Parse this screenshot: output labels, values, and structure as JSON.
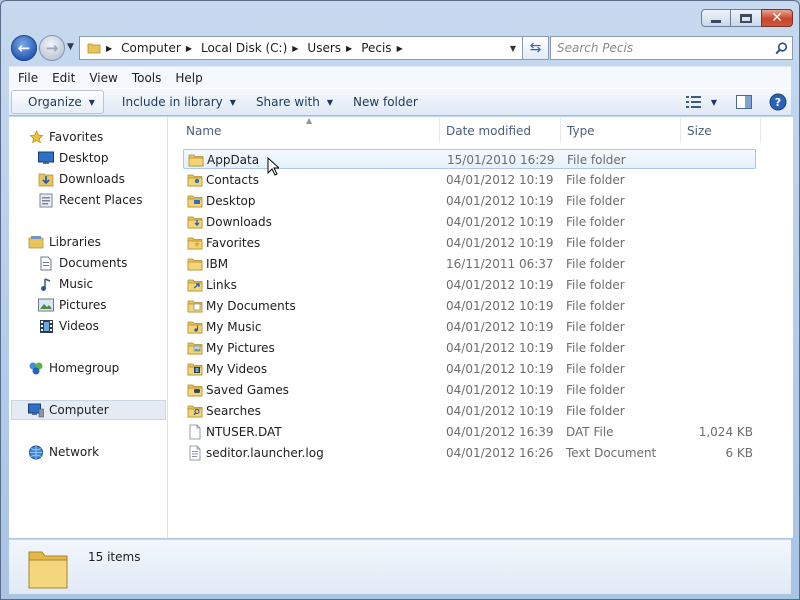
{
  "address": {
    "crumbs": [
      "Computer",
      "Local Disk (C:)",
      "Users",
      "Pecis"
    ],
    "search_placeholder": "Search Pecis"
  },
  "menu": [
    "File",
    "Edit",
    "View",
    "Tools",
    "Help"
  ],
  "commands": {
    "organize": "Organize",
    "include_in_library": "Include in library",
    "share_with": "Share with",
    "new_folder": "New folder"
  },
  "nav": {
    "favorites": {
      "label": "Favorites",
      "items": [
        "Desktop",
        "Downloads",
        "Recent Places"
      ]
    },
    "libraries": {
      "label": "Libraries",
      "items": [
        "Documents",
        "Music",
        "Pictures",
        "Videos"
      ]
    },
    "homegroup": "Homegroup",
    "computer": "Computer",
    "network": "Network"
  },
  "columns": {
    "name": "Name",
    "date": "Date modified",
    "type": "Type",
    "size": "Size"
  },
  "files": [
    {
      "name": "AppData",
      "date": "15/01/2010 16:29",
      "type": "File folder",
      "size": "",
      "icon": "folder-icon",
      "selected": true
    },
    {
      "name": "Contacts",
      "date": "04/01/2012 10:19",
      "type": "File folder",
      "size": "",
      "icon": "contacts-folder-icon"
    },
    {
      "name": "Desktop",
      "date": "04/01/2012 10:19",
      "type": "File folder",
      "size": "",
      "icon": "desktop-folder-icon"
    },
    {
      "name": "Downloads",
      "date": "04/01/2012 10:19",
      "type": "File folder",
      "size": "",
      "icon": "downloads-folder-icon"
    },
    {
      "name": "Favorites",
      "date": "04/01/2012 10:19",
      "type": "File folder",
      "size": "",
      "icon": "favorites-folder-icon"
    },
    {
      "name": "IBM",
      "date": "16/11/2011 06:37",
      "type": "File folder",
      "size": "",
      "icon": "folder-icon"
    },
    {
      "name": "Links",
      "date": "04/01/2012 10:19",
      "type": "File folder",
      "size": "",
      "icon": "links-folder-icon"
    },
    {
      "name": "My Documents",
      "date": "04/01/2012 10:19",
      "type": "File folder",
      "size": "",
      "icon": "documents-folder-icon"
    },
    {
      "name": "My Music",
      "date": "04/01/2012 10:19",
      "type": "File folder",
      "size": "",
      "icon": "music-folder-icon"
    },
    {
      "name": "My Pictures",
      "date": "04/01/2012 10:19",
      "type": "File folder",
      "size": "",
      "icon": "pictures-folder-icon"
    },
    {
      "name": "My Videos",
      "date": "04/01/2012 10:19",
      "type": "File folder",
      "size": "",
      "icon": "videos-folder-icon"
    },
    {
      "name": "Saved Games",
      "date": "04/01/2012 10:19",
      "type": "File folder",
      "size": "",
      "icon": "saved-games-folder-icon"
    },
    {
      "name": "Searches",
      "date": "04/01/2012 10:19",
      "type": "File folder",
      "size": "",
      "icon": "searches-folder-icon"
    },
    {
      "name": "NTUSER.DAT",
      "date": "04/01/2012 16:39",
      "type": "DAT File",
      "size": "1,024 KB",
      "icon": "file-icon"
    },
    {
      "name": "seditor.launcher.log",
      "date": "04/01/2012 16:26",
      "type": "Text Document",
      "size": "6 KB",
      "icon": "text-file-icon"
    }
  ],
  "details": {
    "item_count": "15 items"
  },
  "colors": {
    "folder": "#e8c45a",
    "accent": "#2a62b8",
    "selection": "#e6f0fc"
  }
}
